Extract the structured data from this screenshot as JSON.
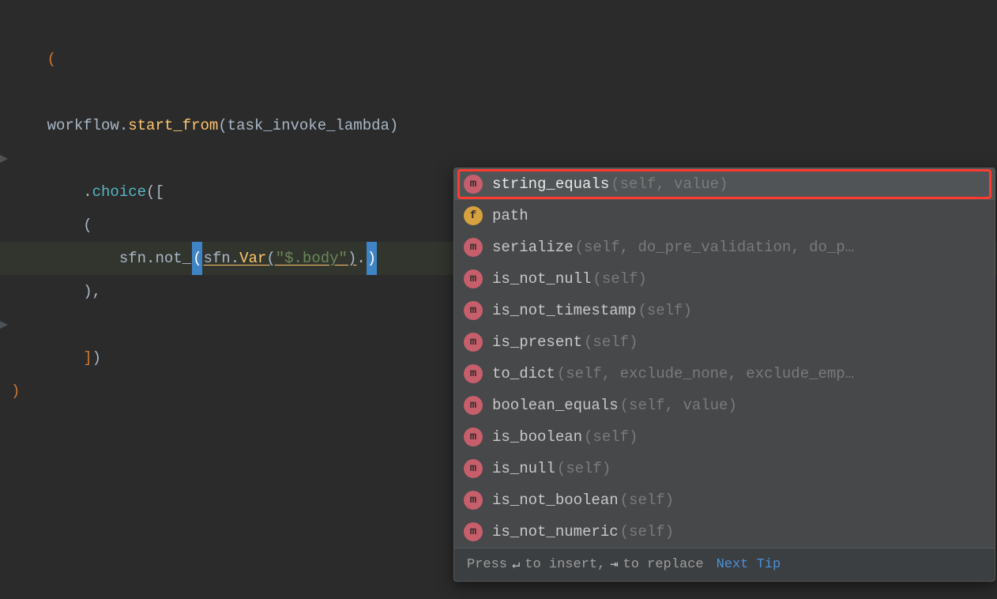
{
  "code": {
    "l1": {
      "p": "("
    },
    "l2": {
      "indent": "    ",
      "obj": "workflow",
      "dot1": ".",
      "fn1": "start_from",
      "po1": "(",
      "arg1": "task_invoke_lambda",
      "pc1": ")"
    },
    "l3": {
      "indent": "    ",
      "dot": ".",
      "fn": "choice",
      "po": "(",
      "br": "["
    },
    "l4": {
      "indent": "        ",
      "p": "("
    },
    "l5": {
      "indent": "            ",
      "obj": "sfn",
      "dot1": ".",
      "fn1": "not_",
      "caret1_open": "(",
      "uobj": "sfn",
      "udot": ".",
      "uvar": "Var",
      "upo": "(",
      "ustr": "\"$.body\"",
      "upc": ")",
      "tdot": ".",
      "caret2_close": ")"
    },
    "l6": {
      "indent": "        ",
      "p": ")",
      "comma": ","
    },
    "l7": {
      "indent": "    ",
      "br": "]",
      "pc": ")"
    },
    "l8": {
      "p": ")"
    }
  },
  "autocomplete": {
    "items": [
      {
        "kind": "m",
        "name": "string_equals",
        "params": "(self, value)",
        "selected": true,
        "redbox": true
      },
      {
        "kind": "f",
        "name": "path",
        "params": ""
      },
      {
        "kind": "m",
        "name": "serialize",
        "params": "(self, do_pre_validation, do_p…"
      },
      {
        "kind": "m",
        "name": "is_not_null",
        "params": "(self)"
      },
      {
        "kind": "m",
        "name": "is_not_timestamp",
        "params": "(self)"
      },
      {
        "kind": "m",
        "name": "is_present",
        "params": "(self)"
      },
      {
        "kind": "m",
        "name": "to_dict",
        "params": "(self, exclude_none, exclude_emp…"
      },
      {
        "kind": "m",
        "name": "boolean_equals",
        "params": "(self, value)"
      },
      {
        "kind": "m",
        "name": "is_boolean",
        "params": "(self)"
      },
      {
        "kind": "m",
        "name": "is_null",
        "params": "(self)"
      },
      {
        "kind": "m",
        "name": "is_not_boolean",
        "params": "(self)"
      },
      {
        "kind": "m",
        "name": "is_not_numeric",
        "params": "(self)"
      }
    ],
    "hint_pre": "Press ",
    "hint_insert_key": "↵",
    "hint_mid1": " to insert, ",
    "hint_replace_key": "⇥",
    "hint_mid2": " to replace",
    "next_tip": "Next Tip"
  }
}
